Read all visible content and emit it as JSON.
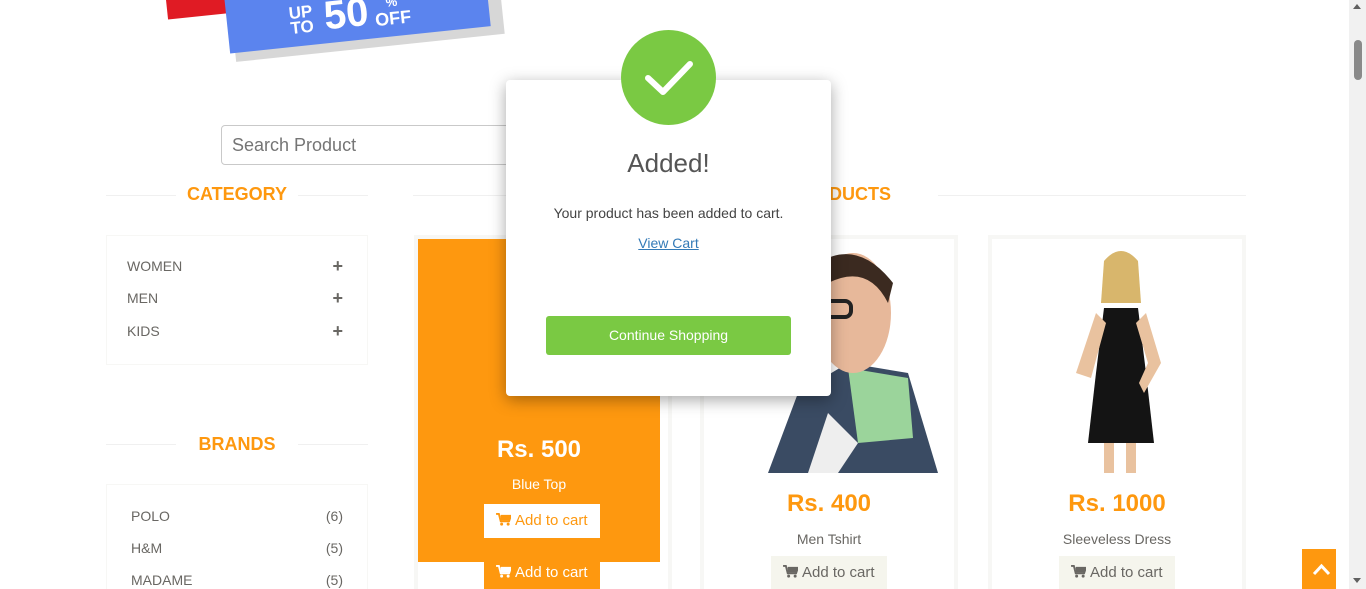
{
  "banner": {
    "upto_line1": "UP",
    "upto_line2": "TO",
    "percent": "50",
    "percent_sign": "%",
    "off": "OFF"
  },
  "search": {
    "placeholder": "Search Product"
  },
  "sidebar": {
    "category_title": "Category",
    "categories": [
      {
        "label": "Women"
      },
      {
        "label": "Men"
      },
      {
        "label": "Kids"
      }
    ],
    "brands_title": "Brands",
    "brands": [
      {
        "label": "Polo",
        "count": "(6)"
      },
      {
        "label": "H&M",
        "count": "(5)"
      },
      {
        "label": "Madame",
        "count": "(5)"
      }
    ]
  },
  "main": {
    "section_title_visible": "PRODUCTS",
    "products": [
      {
        "price": "Rs. 500",
        "name": "Blue Top",
        "add_label": "Add to cart"
      },
      {
        "price": "Rs. 400",
        "name": "Men Tshirt",
        "add_label": "Add to cart"
      },
      {
        "price": "Rs. 1000",
        "name": "Sleeveless Dress",
        "add_label": "Add to cart"
      }
    ]
  },
  "modal": {
    "title": "Added!",
    "message": "Your product has been added to cart.",
    "link": "View Cart",
    "button": "Continue Shopping"
  },
  "colors": {
    "accent": "#fe980f",
    "success": "#7ac943",
    "link": "#337ab7"
  },
  "icons": [
    "check-icon",
    "plus-icon",
    "cart-icon",
    "chevron-up-icon"
  ]
}
